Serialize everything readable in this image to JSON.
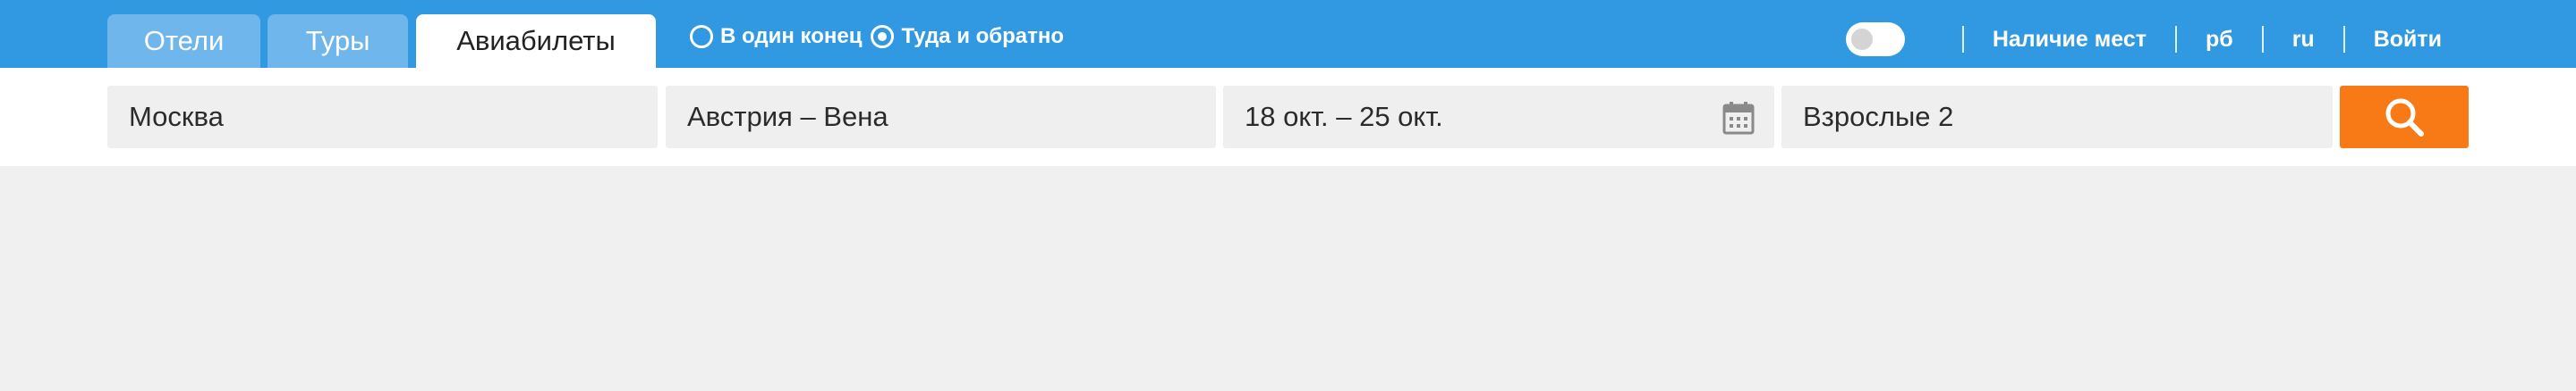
{
  "tabs": [
    {
      "label": "Отели",
      "active": false
    },
    {
      "label": "Туры",
      "active": false
    },
    {
      "label": "Авиабилеты",
      "active": true
    }
  ],
  "trip_type": {
    "options": [
      {
        "label": "В один конец",
        "checked": false
      },
      {
        "label": "Туда и обратно",
        "checked": true
      }
    ]
  },
  "header": {
    "availability_label": "Наличие мест",
    "currency": "рб",
    "language": "ru",
    "login": "Войти",
    "toggle_on": false
  },
  "search": {
    "from": "Москва",
    "to": "Австрия – Вена",
    "dates": "18 окт. – 25 окт.",
    "passengers": "Взрослые 2"
  },
  "colors": {
    "header_bg": "#3199e2",
    "inactive_tab": "#6fb6ec",
    "search_button": "#f87a17",
    "page_bg": "#f0f0f0"
  },
  "icons": {
    "dates": "calendar-icon",
    "search": "search-icon"
  }
}
